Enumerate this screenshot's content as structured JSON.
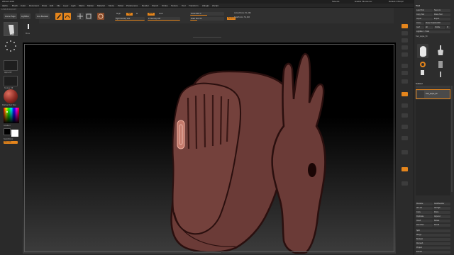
{
  "titlebar": {
    "title": "ZBrush 2019",
    "items": [
      "SaveAs",
      "Enable 'Mouse As'",
      "Default 'ZScript'"
    ]
  },
  "menu": {
    "items": [
      "Alpha",
      "Brush",
      "Color",
      "Document",
      "Draw",
      "Edit",
      "File",
      "Layer",
      "Light",
      "Macro",
      "Marker",
      "Material",
      "Movie",
      "Picker",
      "Preferences",
      "Render",
      "Stencil",
      "Stroke",
      "Texture",
      "Tool",
      "Transform",
      "Zplugin",
      "Zscript"
    ]
  },
  "info": {
    "text": "4.518,35.34,0.207"
  },
  "toolbar": {
    "home_page": "Home Page",
    "lightbox": "LightBox",
    "live_boolean": "Live Boolean",
    "mrgb": "Mrgb",
    "rgb": "Rgb",
    "m": "M",
    "rgb_intensity": "Rgb Intensity 100",
    "zadd": "Zadd",
    "zsub": "Zsub",
    "z_intensity": "Z Intensity 100",
    "focal_shift": "Focal Shift 0",
    "draw_size": "Draw Size 64",
    "dynamic": "Dynamic",
    "active_points": "ActivePoints: 51,266",
    "total_points": "TotalPoints: 51,266"
  },
  "left_shelf": {
    "alpha_label": "Alpha Off",
    "texture_label": "Texture Off",
    "material_label": "MatCap Red Wax",
    "gradient_label": "Gradient",
    "switch_label": "SwitchColor",
    "alternate_label": "Alternate",
    "brush_label": "Move"
  },
  "palette": {
    "title": "Tool",
    "buttons": [
      "Load Tool",
      "Save As",
      "Copy Tool",
      "Paste Tool",
      "Import",
      "Export",
      "Clone",
      "Make PolyMesh3D",
      "GoZ",
      "All",
      "Visible",
      "R",
      "Lightbox > Tools"
    ],
    "current_tool": "Tool_Apple_50",
    "subtool_header": "Subtool",
    "subtool_name": "Tool_Apple_50",
    "lower_buttons": [
      "Rename",
      "AutoReorder",
      "All Low",
      "All High",
      "Copy",
      "Paste",
      "Duplicate",
      "Append",
      "Insert",
      "Delete",
      "Del Other",
      "Del All",
      "Split",
      "Merge",
      "Boolean",
      "Remesh",
      "Project",
      "Extract"
    ]
  },
  "colors": {
    "accent": "#e4851c",
    "mesh": "#6b3b37",
    "mesh_outline": "#2a0f0e"
  }
}
